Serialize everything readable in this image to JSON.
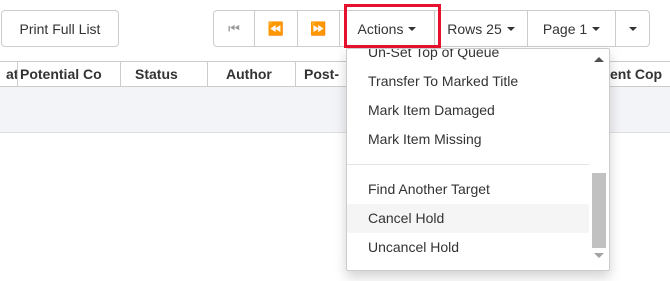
{
  "toolbar": {
    "print_label": "Print Full List",
    "first_icon": "⏮",
    "prev_icon": "⏪",
    "next_icon": "⏩",
    "actions_label": "Actions",
    "rows_label": "Rows 25",
    "page_label": "Page 1"
  },
  "columns": [
    "at",
    "Potential Co",
    "Status",
    "Author",
    "Post-",
    "ent Cop"
  ],
  "actions_menu": {
    "items_top": [
      "Un-Set Top of Queue",
      "Transfer To Marked Title",
      "Mark Item Damaged",
      "Mark Item Missing"
    ],
    "items_bottom": [
      "Find Another Target",
      "Cancel Hold",
      "Uncancel Hold"
    ]
  },
  "colors": {
    "highlight": "#e8112d",
    "row_background": "#f3f4f7",
    "menu_hover": "#f5f5f5"
  }
}
